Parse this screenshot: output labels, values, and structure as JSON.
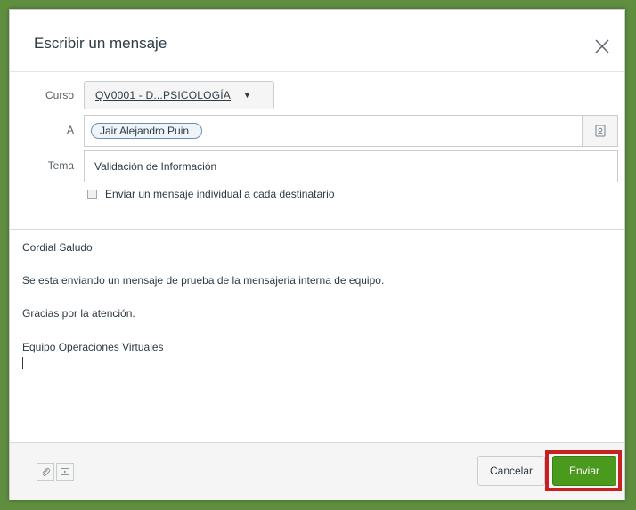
{
  "dialog": {
    "title": "Escribir un mensaje"
  },
  "form": {
    "course_label": "Curso",
    "course_value": "QV0001 - D...PSICOLOGÍA",
    "to_label": "A",
    "recipient": "Jair Alejandro Puin",
    "subject_label": "Tema",
    "subject_value": "Validación de Información",
    "individual_label": "Enviar un mensaje individual a cada destinatario"
  },
  "message": {
    "lines": [
      "Cordial Saludo",
      "Se esta enviando un mensaje de prueba de la mensajeria interna de equipo.",
      "Gracias por la atención.",
      "Equipo Operaciones Virtuales"
    ]
  },
  "footer": {
    "cancel_label": "Cancelar",
    "send_label": "Enviar"
  },
  "icons": {
    "close": "close-icon",
    "address_book": "address-book-icon",
    "attachment": "paperclip-icon",
    "media": "media-icon",
    "caret": "caret-down-icon"
  },
  "colors": {
    "send": "#4a9a1e",
    "highlight": "#c8201e",
    "background": "#5f8f3e"
  }
}
